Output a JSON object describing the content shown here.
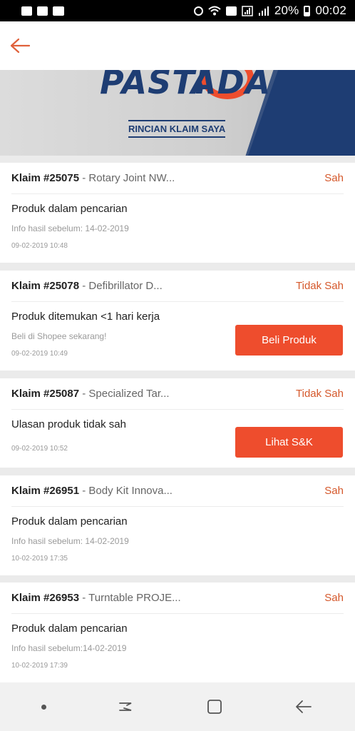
{
  "status_bar": {
    "battery": "20%",
    "time": "00:02"
  },
  "header": {
    "back_icon": "arrow-left-icon",
    "accent_color": "#ee4d2d"
  },
  "banner": {
    "logo_left": "PASTI",
    "logo_right": "ADA",
    "subtitle": "RINCIAN KLAIM SAYA"
  },
  "claims": [
    {
      "id": "Klaim #25075",
      "product": " - Rotary Joint NW...",
      "status": "Sah",
      "title": "Produk dalam pencarian",
      "info": "Info hasil sebelum: 14-02-2019",
      "date": "09-02-2019 10:48",
      "button": ""
    },
    {
      "id": "Klaim #25078",
      "product": " - Defibrillator D...",
      "status": "Tidak Sah",
      "title": "Produk ditemukan <1 hari kerja",
      "info": "Beli di Shopee sekarang!",
      "date": "09-02-2019 10:49",
      "button": "Beli Produk"
    },
    {
      "id": "Klaim #25087",
      "product": " - Specialized Tar...",
      "status": "Tidak Sah",
      "title": "Ulasan produk tidak sah",
      "info": "",
      "date": "09-02-2019 10:52",
      "button": "Lihat S&K"
    },
    {
      "id": "Klaim #26951",
      "product": " - Body Kit Innova...",
      "status": "Sah",
      "title": "Produk dalam pencarian",
      "info": "Info hasil sebelum: 14-02-2019",
      "date": "10-02-2019 17:35",
      "button": ""
    },
    {
      "id": "Klaim #26953",
      "product": " - Turntable PROJE...",
      "status": "Sah",
      "title": "Produk dalam pencarian",
      "info": "Info hasil sebelum:14-02-2019",
      "date": "10-02-2019 17:39",
      "button": ""
    }
  ]
}
